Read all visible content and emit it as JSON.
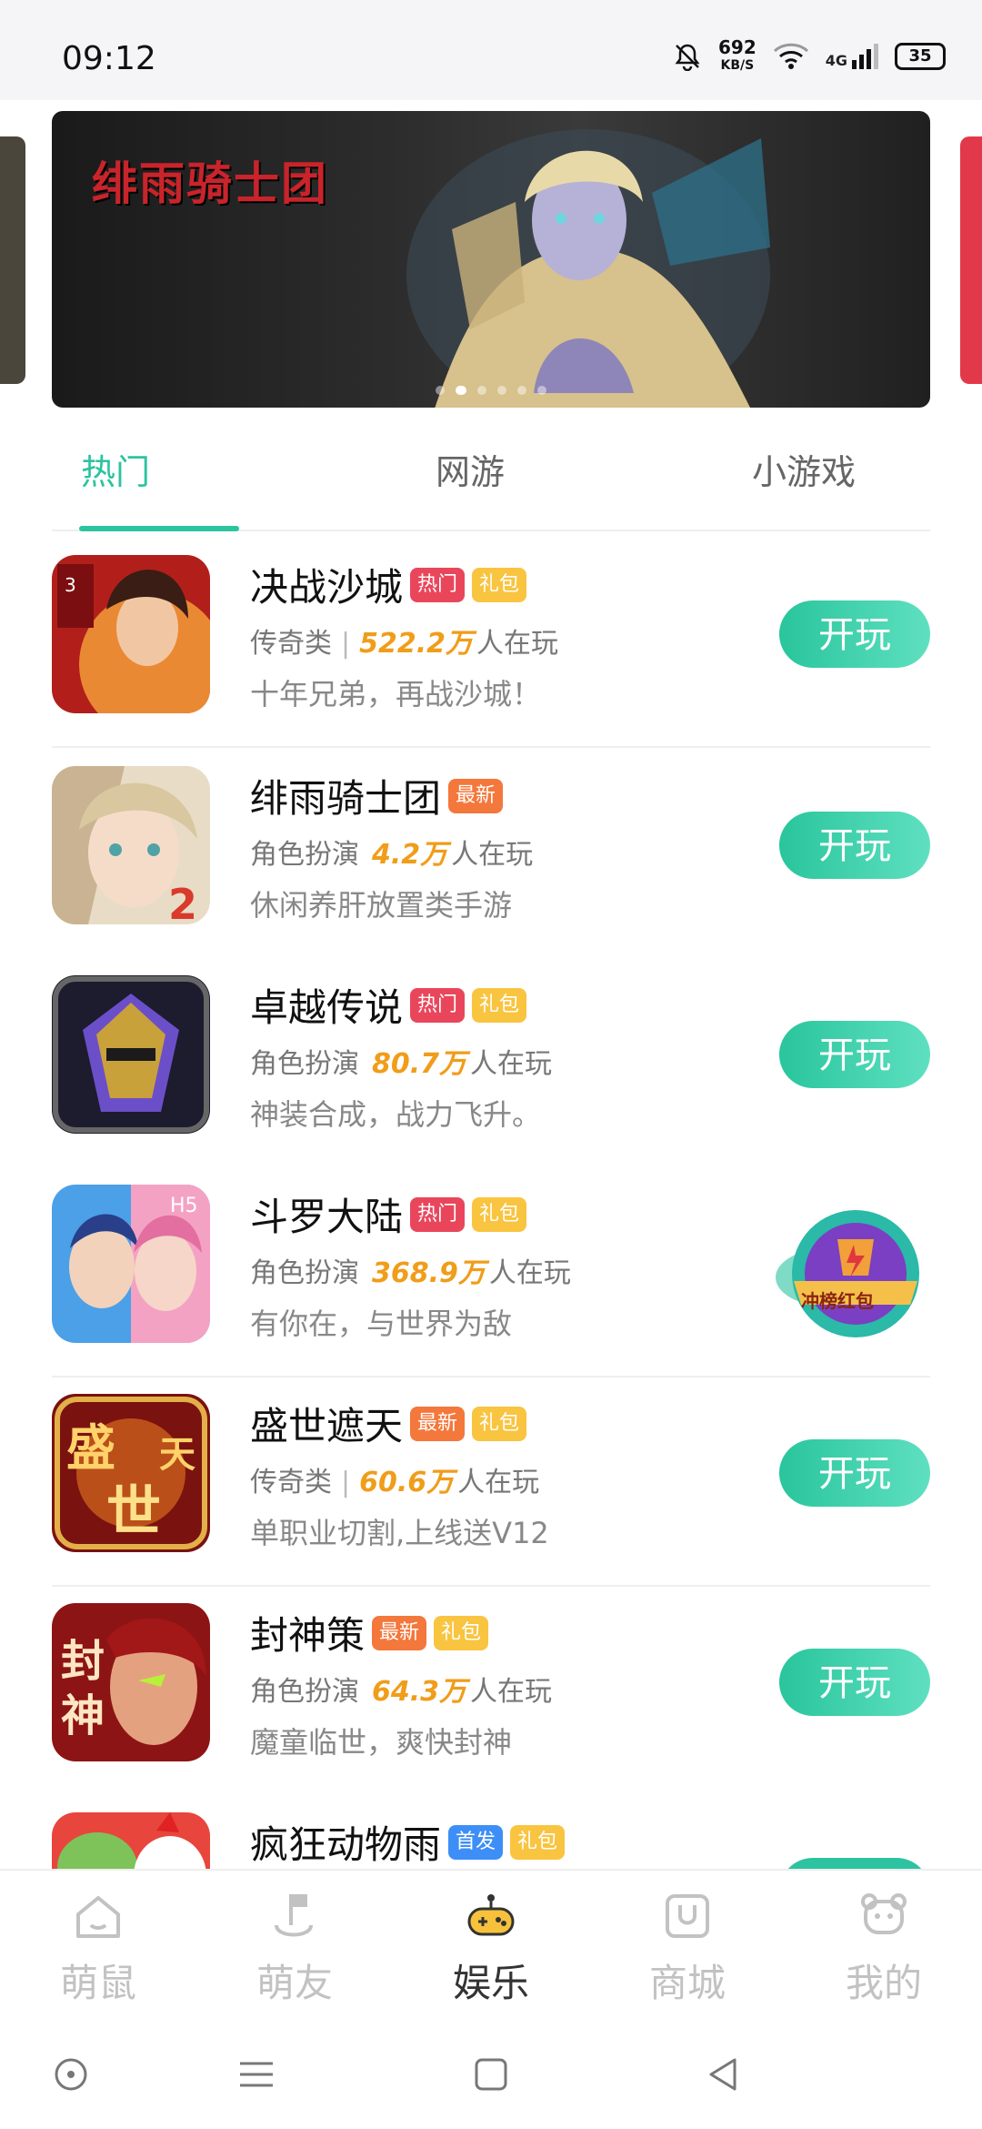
{
  "status_bar": {
    "time": "09:12",
    "speed_value": "692",
    "speed_unit": "KB/S",
    "network": "4G",
    "battery": "35"
  },
  "banner": {
    "logo_text": "绯雨骑士团",
    "dot_count": 6,
    "active_dot": 1
  },
  "tabs": [
    {
      "label": "热门",
      "active": true
    },
    {
      "label": "网游",
      "active": false
    },
    {
      "label": "小游戏",
      "active": false
    }
  ],
  "games": [
    {
      "name": "决战沙城",
      "badges": [
        "热门",
        "礼包"
      ],
      "category": "传奇类",
      "players_num": "522.2万",
      "players_suffix": "人在玩",
      "desc": "十年兄弟，再战沙城！",
      "action": "开玩"
    },
    {
      "name": "绯雨骑士团",
      "badges": [
        "最新"
      ],
      "category": "角色扮演",
      "players_num": "4.2万",
      "players_suffix": "人在玩",
      "desc": "休闲养肝放置类手游",
      "action": "开玩"
    },
    {
      "name": "卓越传说",
      "badges": [
        "热门",
        "礼包"
      ],
      "category": "角色扮演",
      "players_num": "80.7万",
      "players_suffix": "人在玩",
      "desc": "神装合成，战力飞升。",
      "action": "开玩"
    },
    {
      "name": "斗罗大陆",
      "badges": [
        "热门",
        "礼包"
      ],
      "category": "角色扮演",
      "players_num": "368.9万",
      "players_suffix": "人在玩",
      "desc": "有你在，与世界为敌",
      "action": "冲榜红包"
    },
    {
      "name": "盛世遮天",
      "badges": [
        "最新",
        "礼包"
      ],
      "category": "传奇类",
      "players_num": "60.6万",
      "players_suffix": "人在玩",
      "desc": "单职业切割,上线送V12",
      "action": "开玩"
    },
    {
      "name": "封神策",
      "badges": [
        "最新",
        "礼包"
      ],
      "category": "角色扮演",
      "players_num": "64.3万",
      "players_suffix": "人在玩",
      "desc": "魔童临世，爽快封神",
      "action": "开玩"
    },
    {
      "name": "疯狂动物雨",
      "badges": [
        "首发",
        "礼包"
      ]
    }
  ],
  "bottom_nav": [
    {
      "label": "萌鼠",
      "icon": "home-icon",
      "active": false
    },
    {
      "label": "萌友",
      "icon": "friends-icon",
      "active": false
    },
    {
      "label": "娱乐",
      "icon": "gamepad-icon",
      "active": true
    },
    {
      "label": "商城",
      "icon": "shop-bag-icon",
      "active": false
    },
    {
      "label": "我的",
      "icon": "bear-profile-icon",
      "active": false
    }
  ],
  "colors": {
    "accent": "#2cc3a0",
    "hot": "#e9465c",
    "gift": "#f9c440",
    "new": "#f4773b",
    "first": "#3d8ef7",
    "players": "#f09d1a"
  }
}
